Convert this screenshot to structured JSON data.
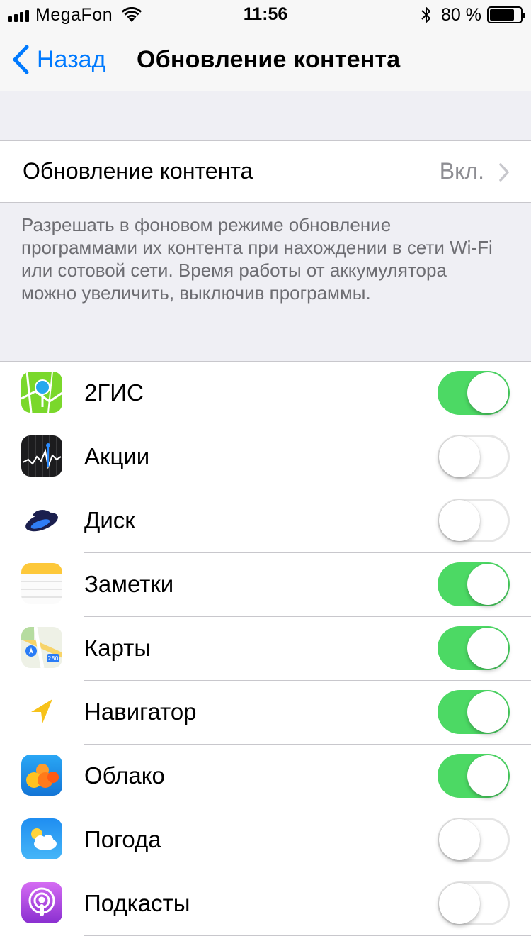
{
  "status_bar": {
    "carrier": "MegaFon",
    "time": "11:56",
    "battery_percent": "80 %",
    "battery_level": 0.8
  },
  "nav": {
    "back_label": "Назад",
    "title": "Обновление контента"
  },
  "main_setting": {
    "label": "Обновление контента",
    "value": "Вкл."
  },
  "footer_text": "Разрешать в фоновом режиме обновление программами их контента при нахождении в сети Wi‑Fi или сотовой сети. Время работы от аккумулятора можно увеличить, выключив программы.",
  "apps": [
    {
      "name": "2ГИС",
      "enabled": true,
      "icon": "2gis-icon"
    },
    {
      "name": "Акции",
      "enabled": false,
      "icon": "stocks-icon"
    },
    {
      "name": "Диск",
      "enabled": false,
      "icon": "disk-icon"
    },
    {
      "name": "Заметки",
      "enabled": true,
      "icon": "notes-icon"
    },
    {
      "name": "Карты",
      "enabled": true,
      "icon": "maps-icon"
    },
    {
      "name": "Навигатор",
      "enabled": true,
      "icon": "navigator-icon"
    },
    {
      "name": "Облако",
      "enabled": true,
      "icon": "cloud-icon"
    },
    {
      "name": "Погода",
      "enabled": false,
      "icon": "weather-icon"
    },
    {
      "name": "Подкасты",
      "enabled": false,
      "icon": "podcasts-icon"
    }
  ],
  "colors": {
    "accent": "#007aff",
    "toggle_on": "#4cd964",
    "background": "#efeff4"
  }
}
